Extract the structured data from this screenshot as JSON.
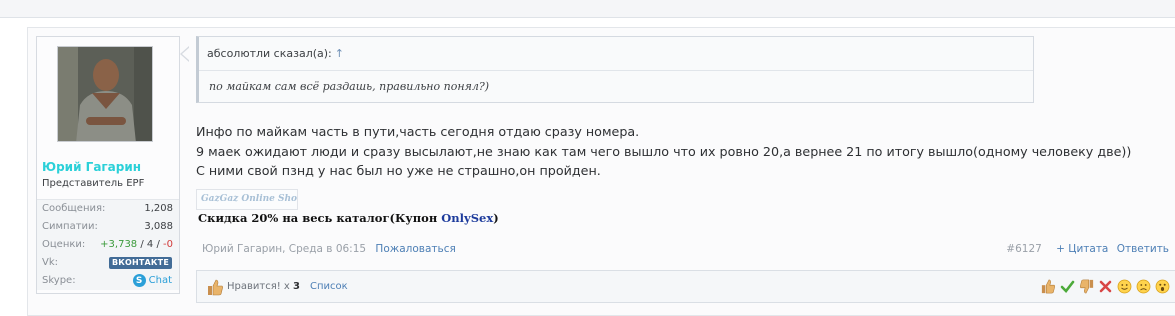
{
  "user": {
    "name": "Юрий Гагарин",
    "title": "Представитель EPF",
    "stats": {
      "messages_label": "Сообщения:",
      "messages_value": "1,208",
      "likes_label": "Симпатии:",
      "likes_value": "3,088",
      "ratings_label": "Оценки:",
      "ratings_pos": "+3,738",
      "ratings_sep1": " / ",
      "ratings_neutral": "4",
      "ratings_sep2": " / ",
      "ratings_neg": "-0",
      "vk_label": "Vk:",
      "vk_badge": "ВКОНТАКТЕ",
      "skype_label": "Skype:",
      "skype_value": "Chat"
    }
  },
  "quote": {
    "author_line": "абсолютли сказал(а):",
    "arrow": "↑",
    "text": "по майкам сам всё раздашь, правильно понял?)"
  },
  "message": {
    "lines": [
      "Инфо по майкам часть в пути,часть сегодня отдаю сразу номера.",
      "9 маек ожидают люди и сразу высылают,не знаю как там чего вышло что их ровно 20,а вернее 21 по итогу вышло(одному человеку две))",
      "С ними свой пзнд у нас был но уже не страшно,он пройден."
    ]
  },
  "signature": {
    "logo_text": "GazGaz Online Shop",
    "text_before": "Скидка 20% на весь каталог(Купон ",
    "coupon": "OnlySex",
    "text_after": ")"
  },
  "meta": {
    "author_date": "Юрий Гагарин, Среда в 06:15",
    "report": "Пожаловаться",
    "post_number": "#6127",
    "quote_link": "+ Цитата",
    "reply_link": "Ответить"
  },
  "likes": {
    "label": "Нравится! x ",
    "count": "3",
    "list_link": "Список"
  },
  "reactions": [
    "thumb-up-icon",
    "check-icon",
    "thumb-down-icon",
    "cross-icon",
    "smile-icon",
    "sad-icon",
    "wow-icon"
  ],
  "colors": {
    "username": "#2bd0d8",
    "link": "#4d7fb5",
    "positive": "#3c9b3c",
    "negative": "#d23a3a",
    "vk": "#426c97",
    "skype": "#2a9fd8"
  }
}
